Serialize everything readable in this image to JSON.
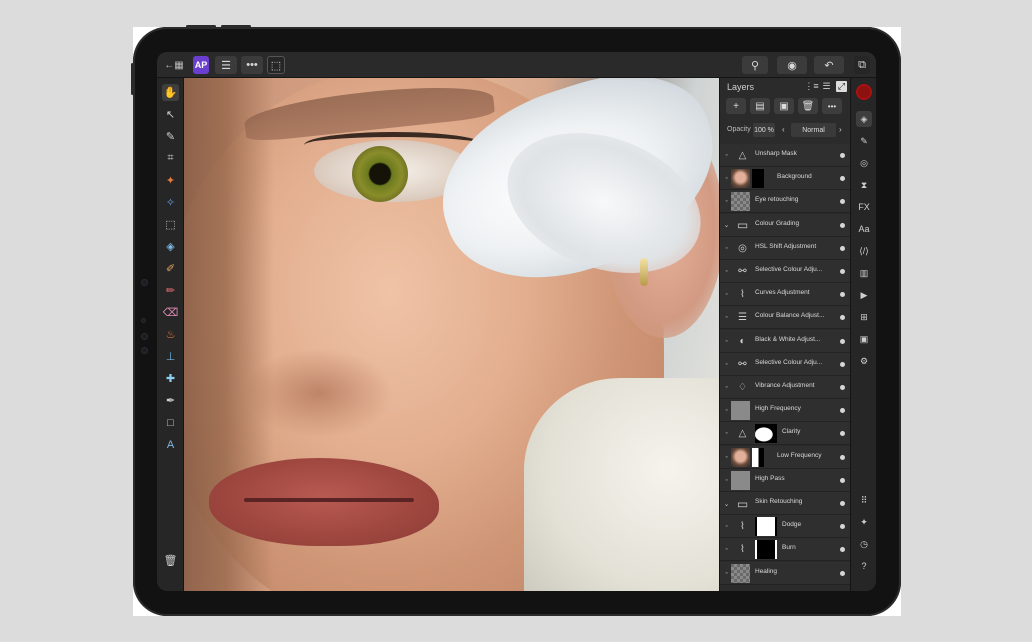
{
  "topbar": {
    "back_icon": "back-grid-icon",
    "app_icon_text": "AP",
    "menu_icon": "hamburger-icon",
    "more_icon": "ellipsis-icon",
    "select_icon": "marquee-icon",
    "right_icons": [
      "zoom-icon",
      "view-icon",
      "undo-icon",
      "export-icon"
    ]
  },
  "left_tools": [
    "hand-icon",
    "move-icon",
    "color-picker-icon",
    "crop-icon",
    "selection-brush-icon",
    "flood-select-icon",
    "marquee-icon",
    "flood-fill-icon",
    "paint-brush-icon",
    "pixel-brush-icon",
    "erase-icon",
    "burn-icon",
    "clone-icon",
    "healing-icon",
    "pen-icon",
    "rectangle-icon",
    "text-icon",
    "trash-icon"
  ],
  "layers_panel": {
    "title": "Layers",
    "buttons": [
      "+",
      "▤",
      "▣",
      "🗑",
      "•••"
    ],
    "opacity_label": "Opacity",
    "opacity_value": "100 %",
    "blend_mode": "Normal",
    "layers": [
      {
        "name": "Unsharp Mask",
        "thumb": "adj",
        "glyph": "△"
      },
      {
        "name": "Background",
        "thumb": "face+mask"
      },
      {
        "name": "Eye retouching",
        "thumb": "checker"
      },
      {
        "name": "Colour Grading",
        "thumb": "folder",
        "glyph": "▭"
      },
      {
        "name": "HSL Shift Adjustment",
        "thumb": "adj",
        "glyph": "◎"
      },
      {
        "name": "Selective Colour Adju...",
        "thumb": "adj",
        "glyph": "⚯"
      },
      {
        "name": "Curves Adjustment",
        "thumb": "adj",
        "glyph": "⌇"
      },
      {
        "name": "Colour Balance Adjust...",
        "thumb": "adj",
        "glyph": "☰"
      },
      {
        "name": "Black & White Adjust...",
        "thumb": "adj",
        "glyph": "◐"
      },
      {
        "name": "Selective Colour Adju...",
        "thumb": "adj",
        "glyph": "⚯"
      },
      {
        "name": "Vibrance Adjustment",
        "thumb": "adj",
        "glyph": "♢"
      },
      {
        "name": "High Frequency",
        "thumb": "grey"
      },
      {
        "name": "Clarity",
        "thumb": "clarity",
        "glyph": "△"
      },
      {
        "name": "Low Frequency",
        "thumb": "face+maskw"
      },
      {
        "name": "High Pass",
        "thumb": "grey"
      },
      {
        "name": "Skin Retouching",
        "thumb": "folder",
        "glyph": "▭"
      },
      {
        "name": "Dodge",
        "thumb": "dodge",
        "glyph": "⌇"
      },
      {
        "name": "Burn",
        "thumb": "burn",
        "glyph": "⌇"
      },
      {
        "name": "Healing",
        "thumb": "checker"
      }
    ]
  },
  "studio_strip": {
    "color": "#8c1111",
    "icons": [
      "layers-icon",
      "brush-icon",
      "navigator-icon",
      "transform-icon",
      "fx-icon",
      "character-icon",
      "text-style-icon",
      "histogram-icon",
      "channels-icon",
      "stock-icon",
      "assets-icon",
      "macro-icon",
      "grid-icon",
      "snapping-icon",
      "history-icon",
      "help-icon"
    ]
  }
}
